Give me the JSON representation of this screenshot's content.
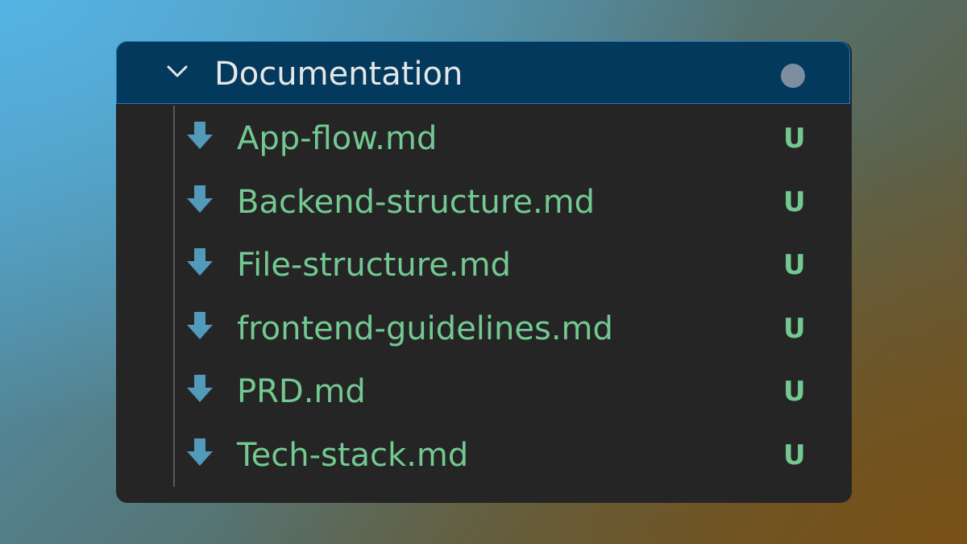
{
  "explorer": {
    "folder": {
      "name": "Documentation",
      "expanded": true,
      "icon": "chevron-down-icon",
      "status": "modified-dot"
    },
    "files": [
      {
        "name": "App-flow.md",
        "status": "U",
        "icon": "markdown-download-icon"
      },
      {
        "name": "Backend-structure.md",
        "status": "U",
        "icon": "markdown-download-icon"
      },
      {
        "name": "File-structure.md",
        "status": "U",
        "icon": "markdown-download-icon"
      },
      {
        "name": "frontend-guidelines.md",
        "status": "U",
        "icon": "markdown-download-icon"
      },
      {
        "name": "PRD.md",
        "status": "U",
        "icon": "markdown-download-icon"
      },
      {
        "name": "Tech-stack.md",
        "status": "U",
        "icon": "markdown-download-icon"
      }
    ]
  },
  "colors": {
    "folder_row_bg": "#04395e",
    "folder_row_border": "#1f7ac4",
    "untracked_text": "#73c991",
    "icon_blue": "#519aba",
    "panel_bg": "#252526"
  }
}
